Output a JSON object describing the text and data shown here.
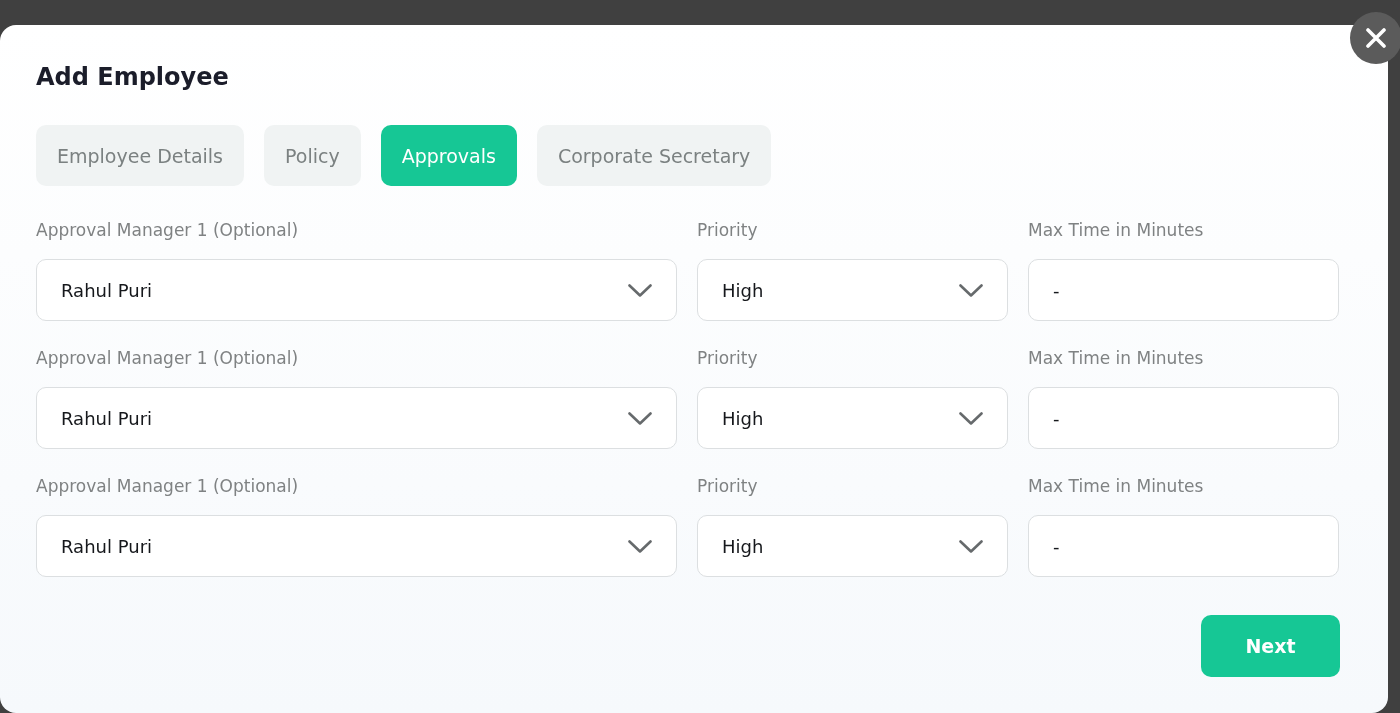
{
  "dialog": {
    "title": "Add Employee"
  },
  "tabs": [
    {
      "label": "Employee Details",
      "selected": false
    },
    {
      "label": "Policy",
      "selected": false
    },
    {
      "label": "Approvals",
      "selected": true
    },
    {
      "label": "Corporate Secretary",
      "selected": false
    }
  ],
  "approvers": [
    {
      "manager": {
        "label": "Approval Manager 1 (Optional)",
        "value": "Rahul Puri"
      },
      "priority": {
        "label": "Priority",
        "value": "High"
      },
      "max_time": {
        "label": "Max Time in Minutes",
        "value": "-"
      }
    },
    {
      "manager": {
        "label": "Approval Manager 1 (Optional)",
        "value": "Rahul Puri"
      },
      "priority": {
        "label": "Priority",
        "value": "High"
      },
      "max_time": {
        "label": "Max Time in Minutes",
        "value": "-"
      }
    },
    {
      "manager": {
        "label": "Approval Manager 1 (Optional)",
        "value": "Rahul Puri"
      },
      "priority": {
        "label": "Priority",
        "value": "High"
      },
      "max_time": {
        "label": "Max Time in Minutes",
        "value": "-"
      }
    }
  ],
  "buttons": {
    "next": "Next"
  }
}
